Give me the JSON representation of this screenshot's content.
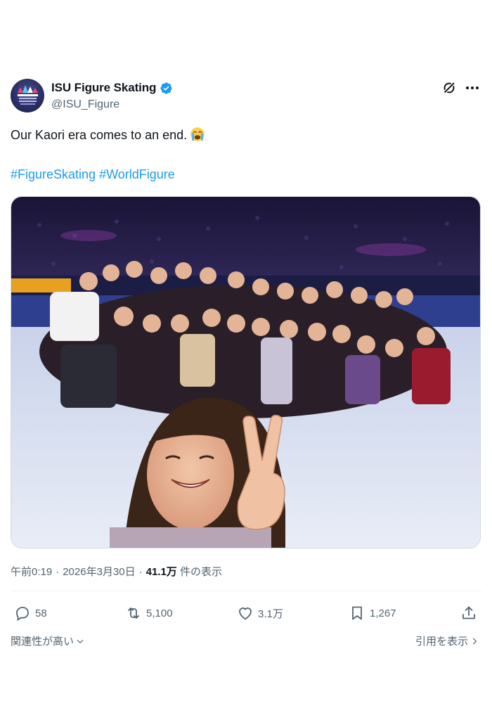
{
  "account": {
    "display_name": "ISU Figure Skating",
    "handle": "@ISU_Figure",
    "verified": true,
    "verified_color": "#1d9bf0"
  },
  "tweet": {
    "text": "Our Kaori era comes to an end.",
    "emoji_icon": "loudly-crying-face-icon",
    "hashtags": [
      "#FigureSkating",
      "#WorldFigure"
    ],
    "media_icon": "group-selfie-photo"
  },
  "meta": {
    "time": "午前0:19",
    "date": "2026年3月30日",
    "separator": "·",
    "views_count": "41.1万",
    "views_label": "件の表示"
  },
  "actions": {
    "replies": "58",
    "reposts": "5,100",
    "likes": "3.1万",
    "bookmarks": "1,267"
  },
  "footer": {
    "sort_label": "関連性が高い",
    "quotes_label": "引用を表示"
  },
  "colors": {
    "text": "#0f1419",
    "secondary": "#536471",
    "link": "#1d9bf0"
  }
}
